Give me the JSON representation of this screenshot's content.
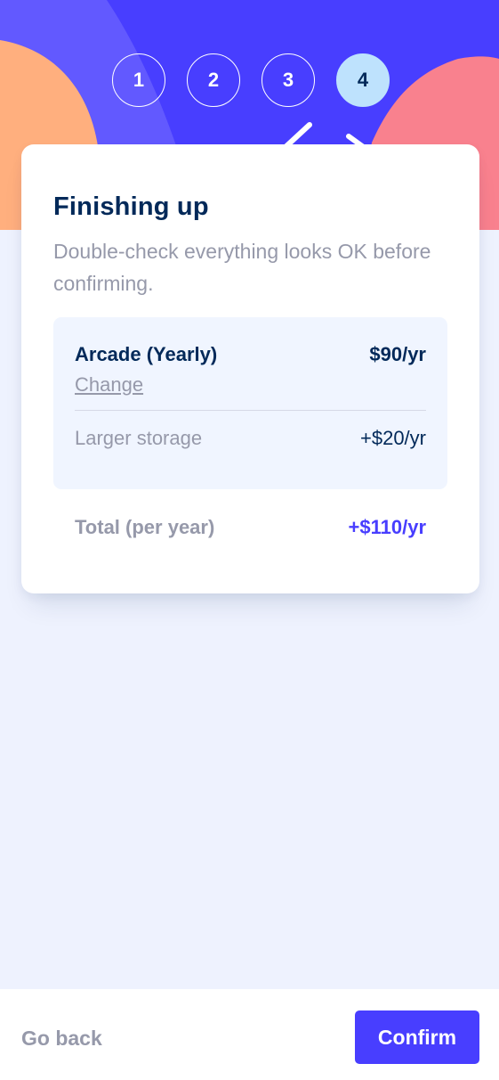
{
  "colors": {
    "primary": "#483eff",
    "marine_blue": "#022959",
    "grey": "#9699aa",
    "light_blue": "#bee2fd",
    "background": "#eef2fe",
    "orange_shape": "#ffaf7e",
    "pink_shape": "#f9818e"
  },
  "steps": [
    "1",
    "2",
    "3",
    "4"
  ],
  "active_step": "4",
  "card": {
    "title": "Finishing up",
    "subtitle": "Double-check everything looks OK before confirming."
  },
  "summary": {
    "plan_name": "Arcade (Yearly)",
    "plan_change": "Change",
    "plan_price": "$90/yr",
    "addons": [
      {
        "name": "Larger storage",
        "price": "+$20/yr"
      }
    ]
  },
  "total": {
    "label": "Total (per year)",
    "price": "+$110/yr"
  },
  "footer": {
    "back_label": "Go back",
    "confirm_label": "Confirm"
  },
  "icons": [
    "decorative-orange-blob-icon",
    "decorative-pink-blob-icon",
    "decorative-lines-icon"
  ]
}
